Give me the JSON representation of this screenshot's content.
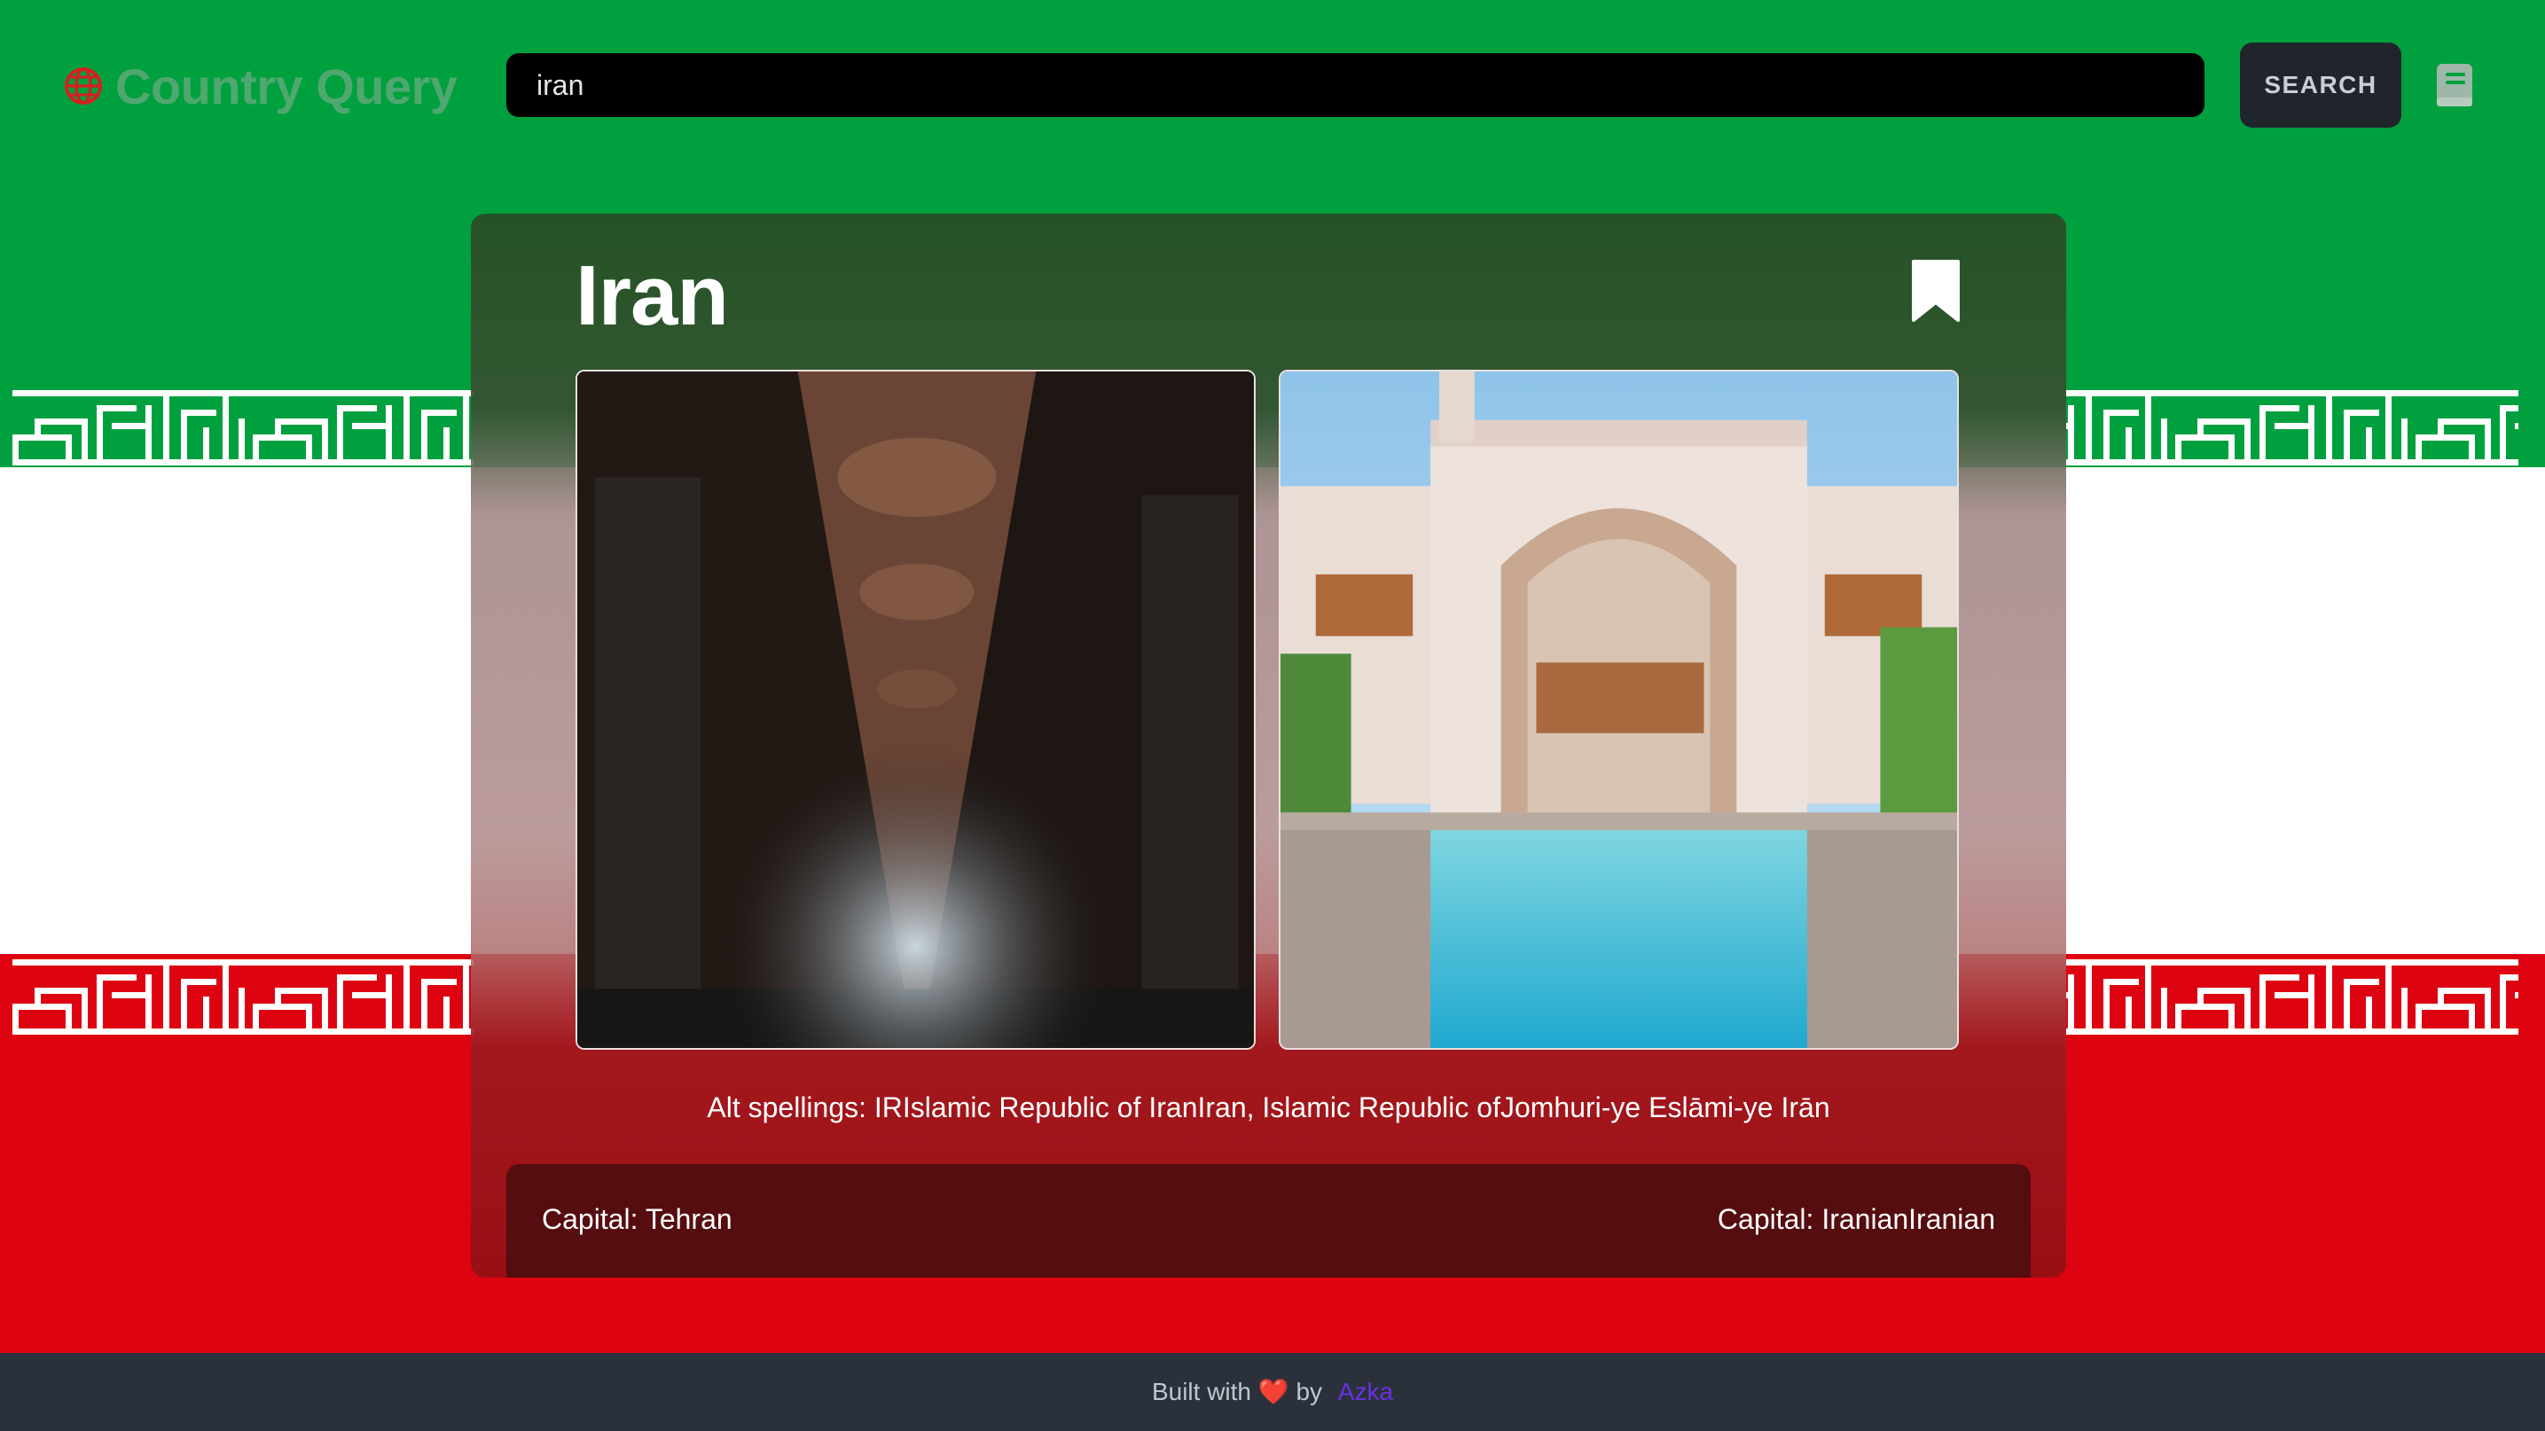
{
  "header": {
    "brand_title": "Country Query",
    "brand_icon": "globe-icon",
    "search_value": "iran",
    "search_button_label": "SEARCH",
    "saved_icon": "book-icon"
  },
  "country": {
    "name": "Iran",
    "bookmark_icon": "bookmark-icon",
    "photos": [
      {
        "subject": "bazaar-corridor"
      },
      {
        "subject": "courtyard-pool-mansion"
      }
    ],
    "alt_spellings": "Alt spellings: IRIslamic Republic of IranIran, Islamic Republic ofJomhuri-ye Eslāmi-ye Irān",
    "capital_text": "Capital: Tehran",
    "demonym_text": "Capital: IranianIranian"
  },
  "footer": {
    "built_with": "Built with",
    "heart": "❤️",
    "by": "by",
    "author": "Azka"
  },
  "colors": {
    "flag_green": "#00a03e",
    "flag_white": "#ffffff",
    "flag_red": "#dd0311",
    "search_bg": "#000000",
    "button_bg": "#20252c",
    "footer_bg": "#2b313a",
    "author_link": "#6b2fe0"
  }
}
